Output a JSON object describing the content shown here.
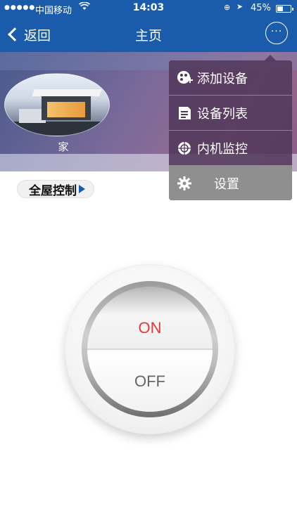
{
  "status_bar": {
    "signal_dots": "●●●●●",
    "carrier": "中国移动",
    "wifi_icon": "wifi-icon",
    "time": "14:03",
    "battery_text": "45%",
    "battery_level": 0.45
  },
  "nav": {
    "back_label": "返回",
    "title": "主页",
    "more_label": "···"
  },
  "banner": {
    "home_label": "家"
  },
  "control": {
    "whole_house_label": "全屋控制"
  },
  "knob": {
    "on_label": "ON",
    "off_label": "OFF",
    "on_color": "#e03a3a"
  },
  "menu": {
    "items": [
      {
        "label": "添加设备",
        "icon": "add-device-icon"
      },
      {
        "label": "设备列表",
        "icon": "device-list-icon"
      },
      {
        "label": "内机监控",
        "icon": "monitor-icon"
      },
      {
        "label": "设置",
        "icon": "gear-icon"
      }
    ]
  },
  "colors": {
    "nav_bar": "#1a5cab",
    "menu_bg": "#50375a",
    "menu_active": "#8f8f8f"
  }
}
